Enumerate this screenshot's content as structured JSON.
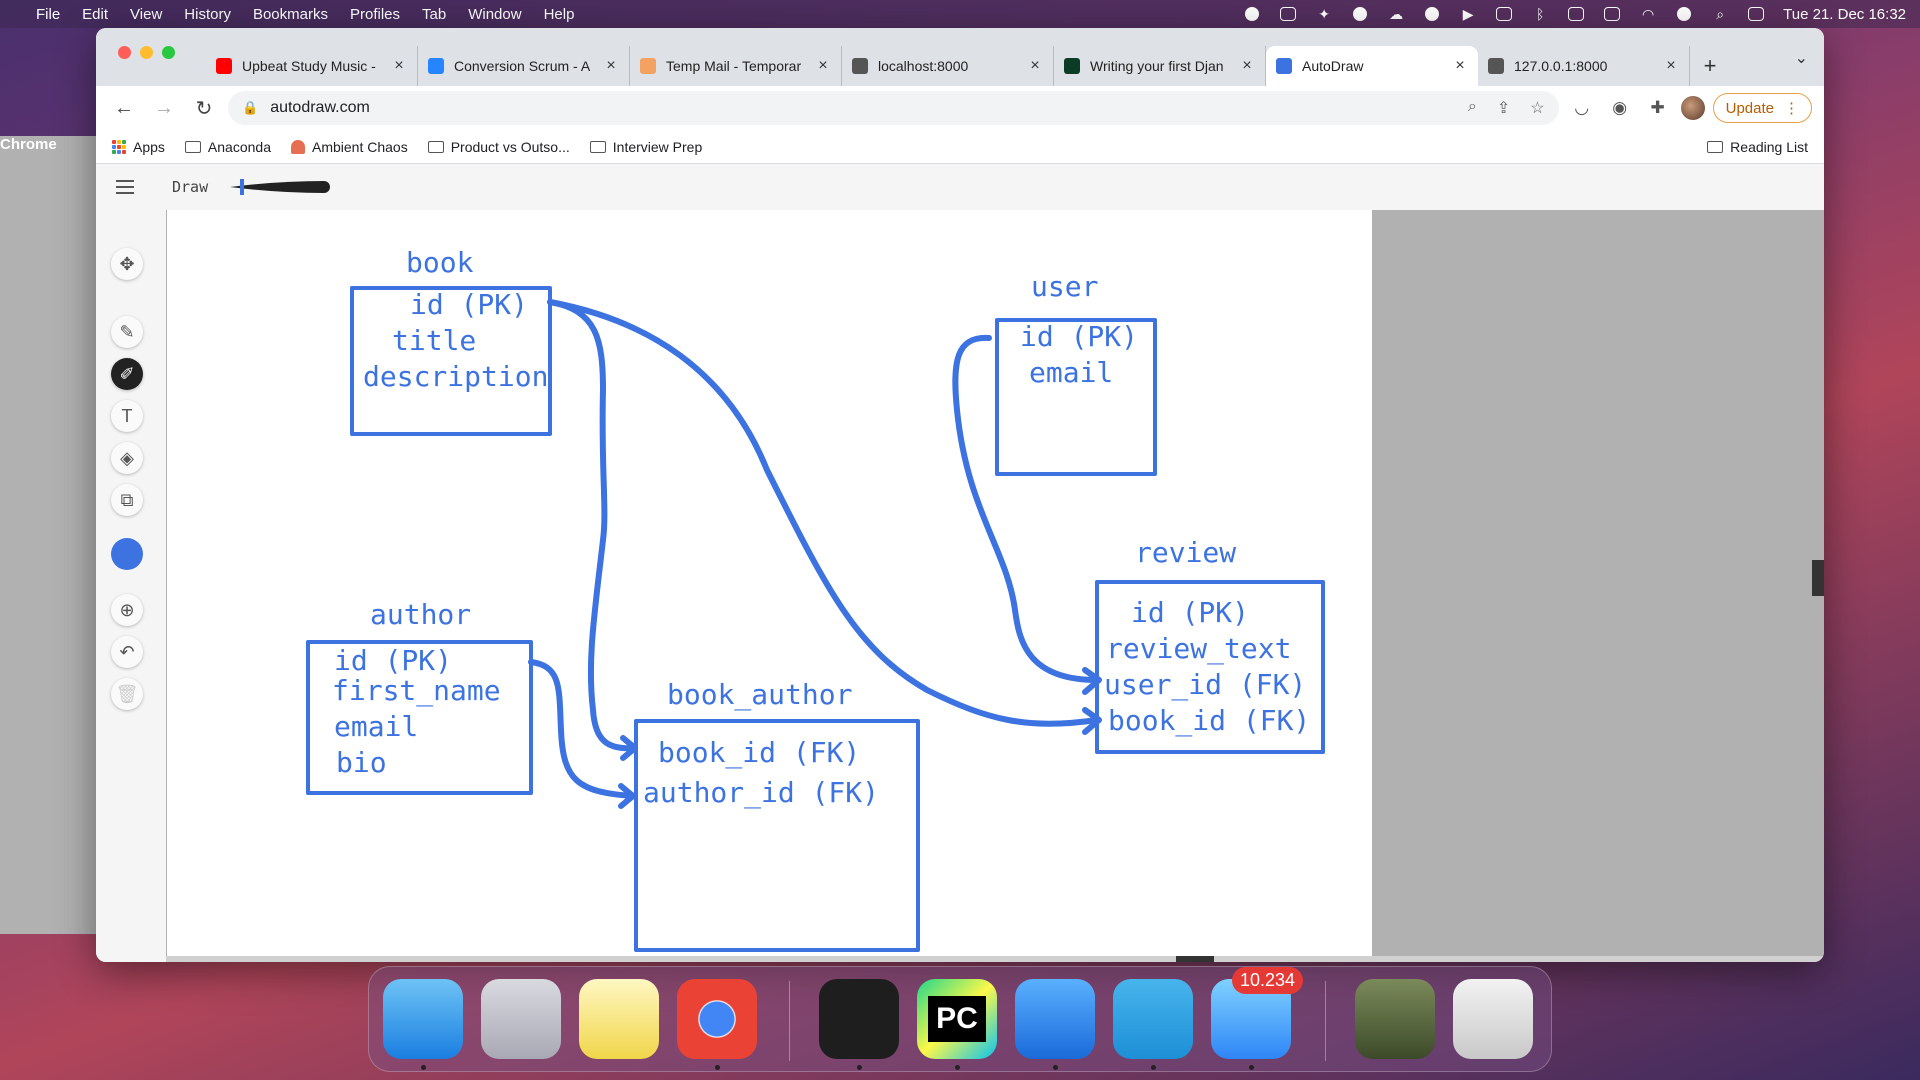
{
  "menubar": {
    "app_name": "Chrome",
    "items": [
      "File",
      "Edit",
      "View",
      "History",
      "Bookmarks",
      "Profiles",
      "Tab",
      "Window",
      "Help"
    ],
    "clock": "Tue 21. Dec  16:32"
  },
  "tabs": [
    {
      "label": "Upbeat Study Music -",
      "icon": "youtube-icon",
      "color": "#ff0000"
    },
    {
      "label": "Conversion Scrum - A",
      "icon": "jira-icon",
      "color": "#2684ff"
    },
    {
      "label": "Temp Mail - Temporar",
      "icon": "mail-icon",
      "color": "#f4a261"
    },
    {
      "label": "localhost:8000",
      "icon": "globe-icon",
      "color": "#555555"
    },
    {
      "label": "Writing your first Djan",
      "icon": "django-icon",
      "color": "#0c3c26"
    },
    {
      "label": "AutoDraw",
      "icon": "autodraw-icon",
      "color": "#3c73e0",
      "active": true
    },
    {
      "label": "127.0.0.1:8000",
      "icon": "globe-icon",
      "color": "#555555"
    }
  ],
  "address": {
    "url": "autodraw.com"
  },
  "update_label": "Update",
  "bookmarks": [
    {
      "label": "Apps",
      "icon": "apps-grid-icon"
    },
    {
      "label": "Anaconda",
      "icon": "folder-icon"
    },
    {
      "label": "Ambient Chaos",
      "icon": "bell-icon"
    },
    {
      "label": "Product vs Outso...",
      "icon": "folder-icon"
    },
    {
      "label": "Interview Prep",
      "icon": "folder-icon"
    }
  ],
  "reading_list": "Reading List",
  "app": {
    "mode_label": "Draw",
    "ink_color": "#3c73e0"
  },
  "diagram": {
    "tables": [
      {
        "name": "book",
        "fields": [
          "id (PK)",
          "title",
          "description"
        ]
      },
      {
        "name": "user",
        "fields": [
          "id (PK)",
          "email"
        ]
      },
      {
        "name": "author",
        "fields": [
          "id (PK)",
          "first_name",
          "email",
          "bio"
        ]
      },
      {
        "name": "book_author",
        "fields": [
          "book_id (FK)",
          "author_id (FK)"
        ]
      },
      {
        "name": "review",
        "fields": [
          "id (PK)",
          "review_text",
          "user_id (FK)",
          "book_id (FK)"
        ]
      }
    ]
  },
  "dock": {
    "apps": [
      {
        "name": "Finder",
        "icon": "finder-icon"
      },
      {
        "name": "Launchpad",
        "icon": "launchpad-icon"
      },
      {
        "name": "Notes",
        "icon": "notes-icon"
      },
      {
        "name": "Chrome",
        "icon": "chrome-icon"
      },
      {
        "name": "Terminal",
        "icon": "terminal-icon"
      },
      {
        "name": "PyCharm",
        "icon": "pycharm-icon",
        "text": "PC"
      },
      {
        "name": "Keynote",
        "icon": "keynote-icon"
      },
      {
        "name": "Telegram",
        "icon": "telegram-icon"
      },
      {
        "name": "Mail",
        "icon": "mail-icon",
        "badge": "10.234"
      },
      {
        "name": "Preview",
        "icon": "preview-icon"
      },
      {
        "name": "Trash",
        "icon": "trash-icon"
      }
    ]
  }
}
